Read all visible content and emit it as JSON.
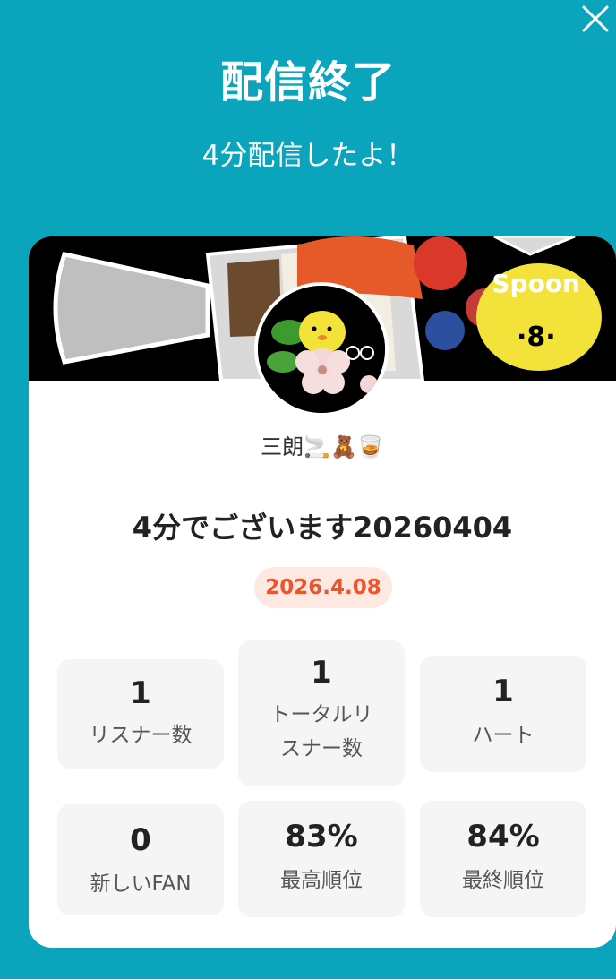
{
  "header": {
    "title": "配信終了",
    "subtitle": "4分配信したよ！"
  },
  "banner": {
    "brand": "Spoon"
  },
  "profile": {
    "username": "三朗🚬🧸🥃"
  },
  "broadcast": {
    "title": "4分でございます20260404",
    "date": "2026.4.08"
  },
  "stats": [
    {
      "value": "1",
      "label_lines": [
        "リスナー数"
      ]
    },
    {
      "value": "1",
      "label_lines": [
        "トータルリ",
        "スナー数"
      ]
    },
    {
      "value": "1",
      "label_lines": [
        "ハート"
      ]
    },
    {
      "value": "0",
      "label_lines": [
        "新しいFAN"
      ]
    },
    {
      "value": "83%",
      "label_lines": [
        "最高順位"
      ]
    },
    {
      "value": "84%",
      "label_lines": [
        "最終順位"
      ]
    }
  ],
  "colors": {
    "background": "#0aa5bd",
    "date_badge_bg": "#fde8e2",
    "date_badge_text": "#e8552f"
  }
}
